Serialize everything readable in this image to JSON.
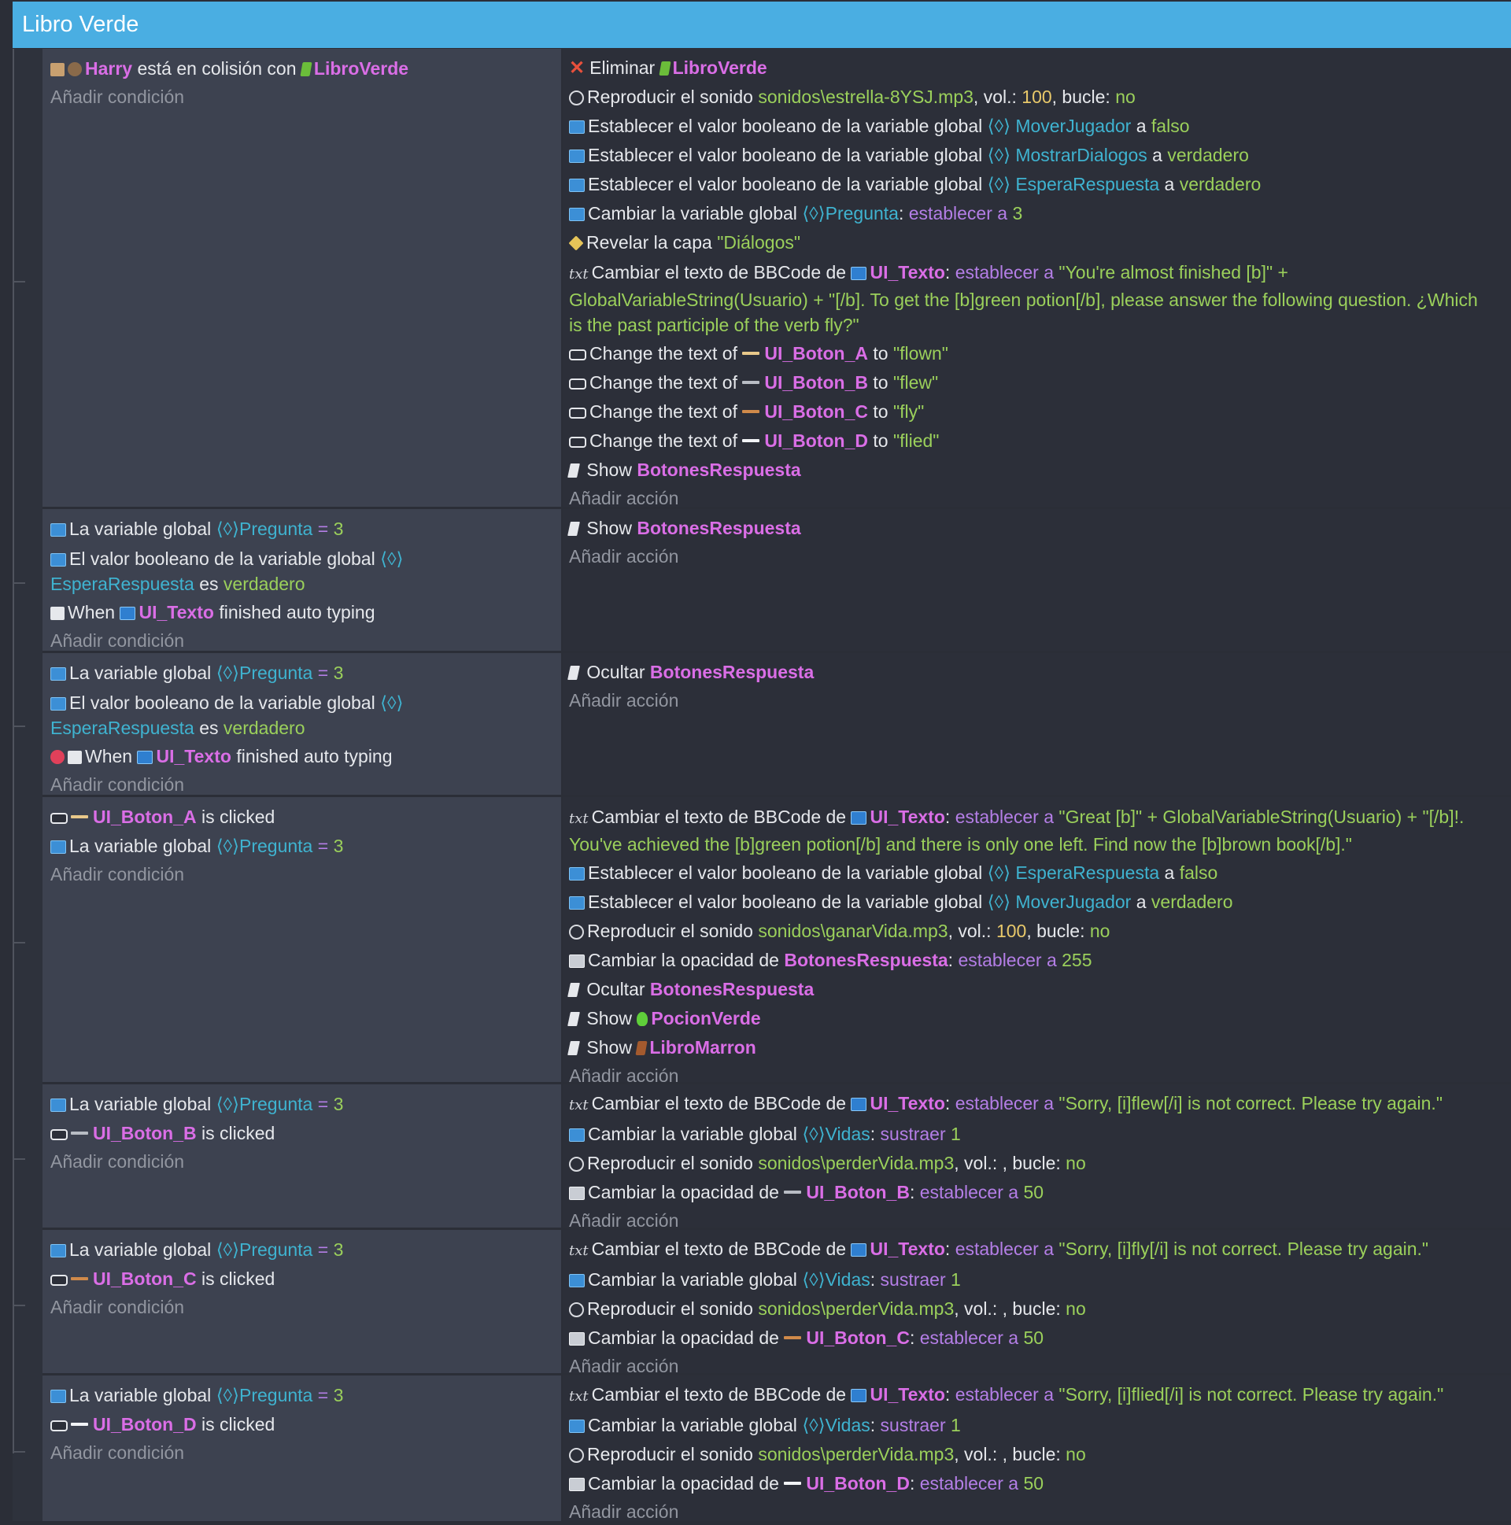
{
  "header": {
    "title": "Libro Verde"
  },
  "add_condition": "Añadir condición",
  "add_action": "Añadir acción",
  "t": {
    "harry": "Harry",
    "en_colision": "está en colisión con",
    "libro_verde": "LibroVerde",
    "eliminar": "Eliminar",
    "reproducir": "Reproducir el sonido",
    "vol": ", vol.:",
    "vol_empty": ", vol.: , bucle:",
    "bucle": ", bucle:",
    "no": "no",
    "n100": "100",
    "snd_estrella": "sonidos\\estrella-8YSJ.mp3",
    "snd_ganar": "sonidos\\ganarVida.mp3",
    "snd_perder": "sonidos\\perderVida.mp3",
    "establecer_bool": "Establecer el valor booleano de la variable global",
    "mover": "MoverJugador",
    "mostrar": "MostrarDialogos",
    "espera": "EsperaRespuesta",
    "a": "a",
    "falso": "falso",
    "verdadero": "verdadero",
    "cambiar_var": "Cambiar la variable global",
    "pregunta": "Pregunta",
    "pregunta_colon": "Pregunta",
    "establecer_a": "establecer a",
    "n3": "3",
    "revelar": "Revelar la capa",
    "dialogos": "\"Diálogos\"",
    "cambiar_bbcode": "Cambiar el texto de BBCode de",
    "ui_texto": "UI_Texto",
    "colon": ":",
    "texto_pregunta": "\"You're almost finished [b]\" + GlobalVariableString(Usuario) + \"[/b]. To get the [b]green potion[/b], please answer the following question. ¿Which is the past participle of the verb fly?\"",
    "change_text_of": "Change the text of",
    "to": "to",
    "boton_a": "UI_Boton_A",
    "boton_b": "UI_Boton_B",
    "boton_c": "UI_Boton_C",
    "boton_d": "UI_Boton_D",
    "flown": "\"flown\"",
    "flew": "\"flew\"",
    "fly": "\"fly\"",
    "flied": "\"flied\"",
    "show": "Show",
    "ocultar": "Ocultar",
    "botones": "BotonesRespuesta",
    "la_variable_global": "La variable global",
    "eq": "=",
    "valor_bool": "El valor booleano de la variable global",
    "es": "es",
    "when": "When",
    "finished_typing": "finished auto typing",
    "is_clicked": "is clicked",
    "texto_great": "\"Great [b]\" + GlobalVariableString(Usuario) + \"[/b]!. You've achieved the [b]green potion[/b] and there is only one left. Find now the [b]brown book[/b].\"",
    "cambiar_opacidad": "Cambiar la opacidad de",
    "n255": "255",
    "n50": "50",
    "pocion": "PocionVerde",
    "libro_marron": "LibroMarron",
    "vidas": "Vidas",
    "sustraer": "sustraer",
    "n1": "1",
    "sorry_flew": "\"Sorry, [i]flew[/i] is not correct. Please try again.\"",
    "sorry_fly": "\"Sorry, [i]fly[/i] is not correct. Please try again.\"",
    "sorry_flied": "\"Sorry, [i]flied[/i] is not correct. Please try again.\""
  }
}
